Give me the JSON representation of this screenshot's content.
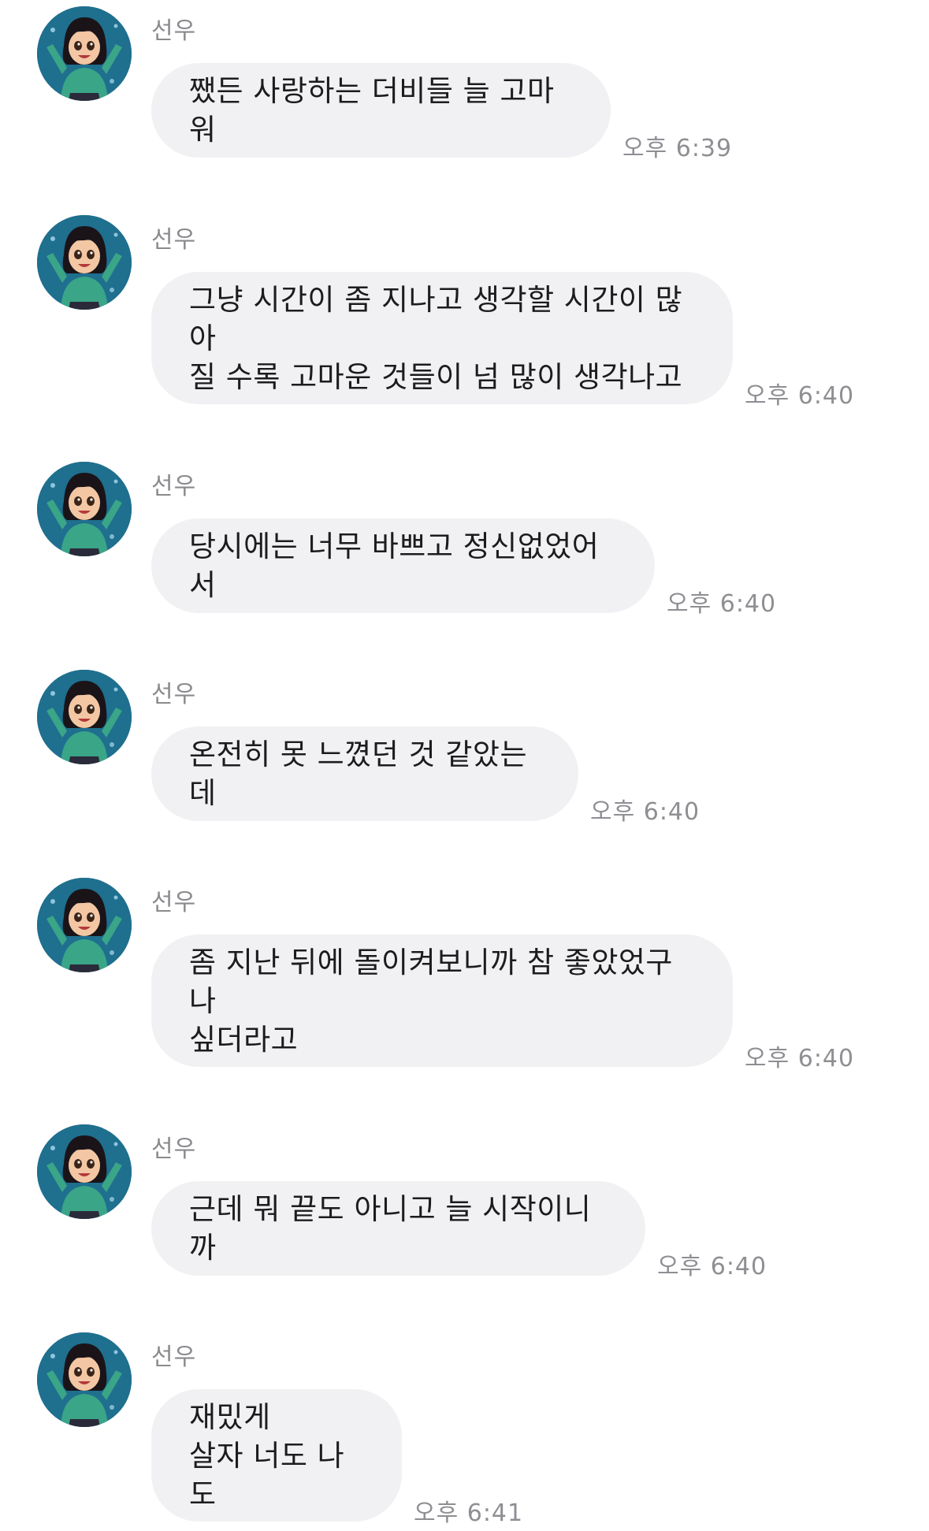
{
  "messages": [
    {
      "sender": "선우",
      "text": "쨌든 사랑하는 더비들 늘 고마워",
      "time": "오후 6:39",
      "avatar_icon": "girl-character-avatar-icon"
    },
    {
      "sender": "선우",
      "text": "그냥 시간이 좀 지나고 생각할 시간이 많아\n질 수록 고마운 것들이 넘 많이 생각나고",
      "time": "오후 6:40",
      "avatar_icon": "girl-character-avatar-icon"
    },
    {
      "sender": "선우",
      "text": "당시에는 너무 바쁘고 정신없었어서",
      "time": "오후 6:40",
      "avatar_icon": "girl-character-avatar-icon"
    },
    {
      "sender": "선우",
      "text": "온전히 못 느꼈던 것 같았는데",
      "time": "오후 6:40",
      "avatar_icon": "girl-character-avatar-icon"
    },
    {
      "sender": "선우",
      "text": "좀 지난 뒤에 돌이켜보니까 참 좋았었구나\n싶더라고",
      "time": "오후 6:40",
      "avatar_icon": "girl-character-avatar-icon"
    },
    {
      "sender": "선우",
      "text": "근데 뭐 끝도 아니고 늘 시작이니까",
      "time": "오후 6:40",
      "avatar_icon": "girl-character-avatar-icon"
    },
    {
      "sender": "선우",
      "text": "재밌게\n살자 너도 나도",
      "time": "오후 6:41",
      "avatar_icon": "girl-character-avatar-icon"
    }
  ],
  "colors": {
    "bubble": "#f1f1f3",
    "sender": "#8a8a8e",
    "time": "#8e8e93",
    "text": "#1c1c1e"
  }
}
